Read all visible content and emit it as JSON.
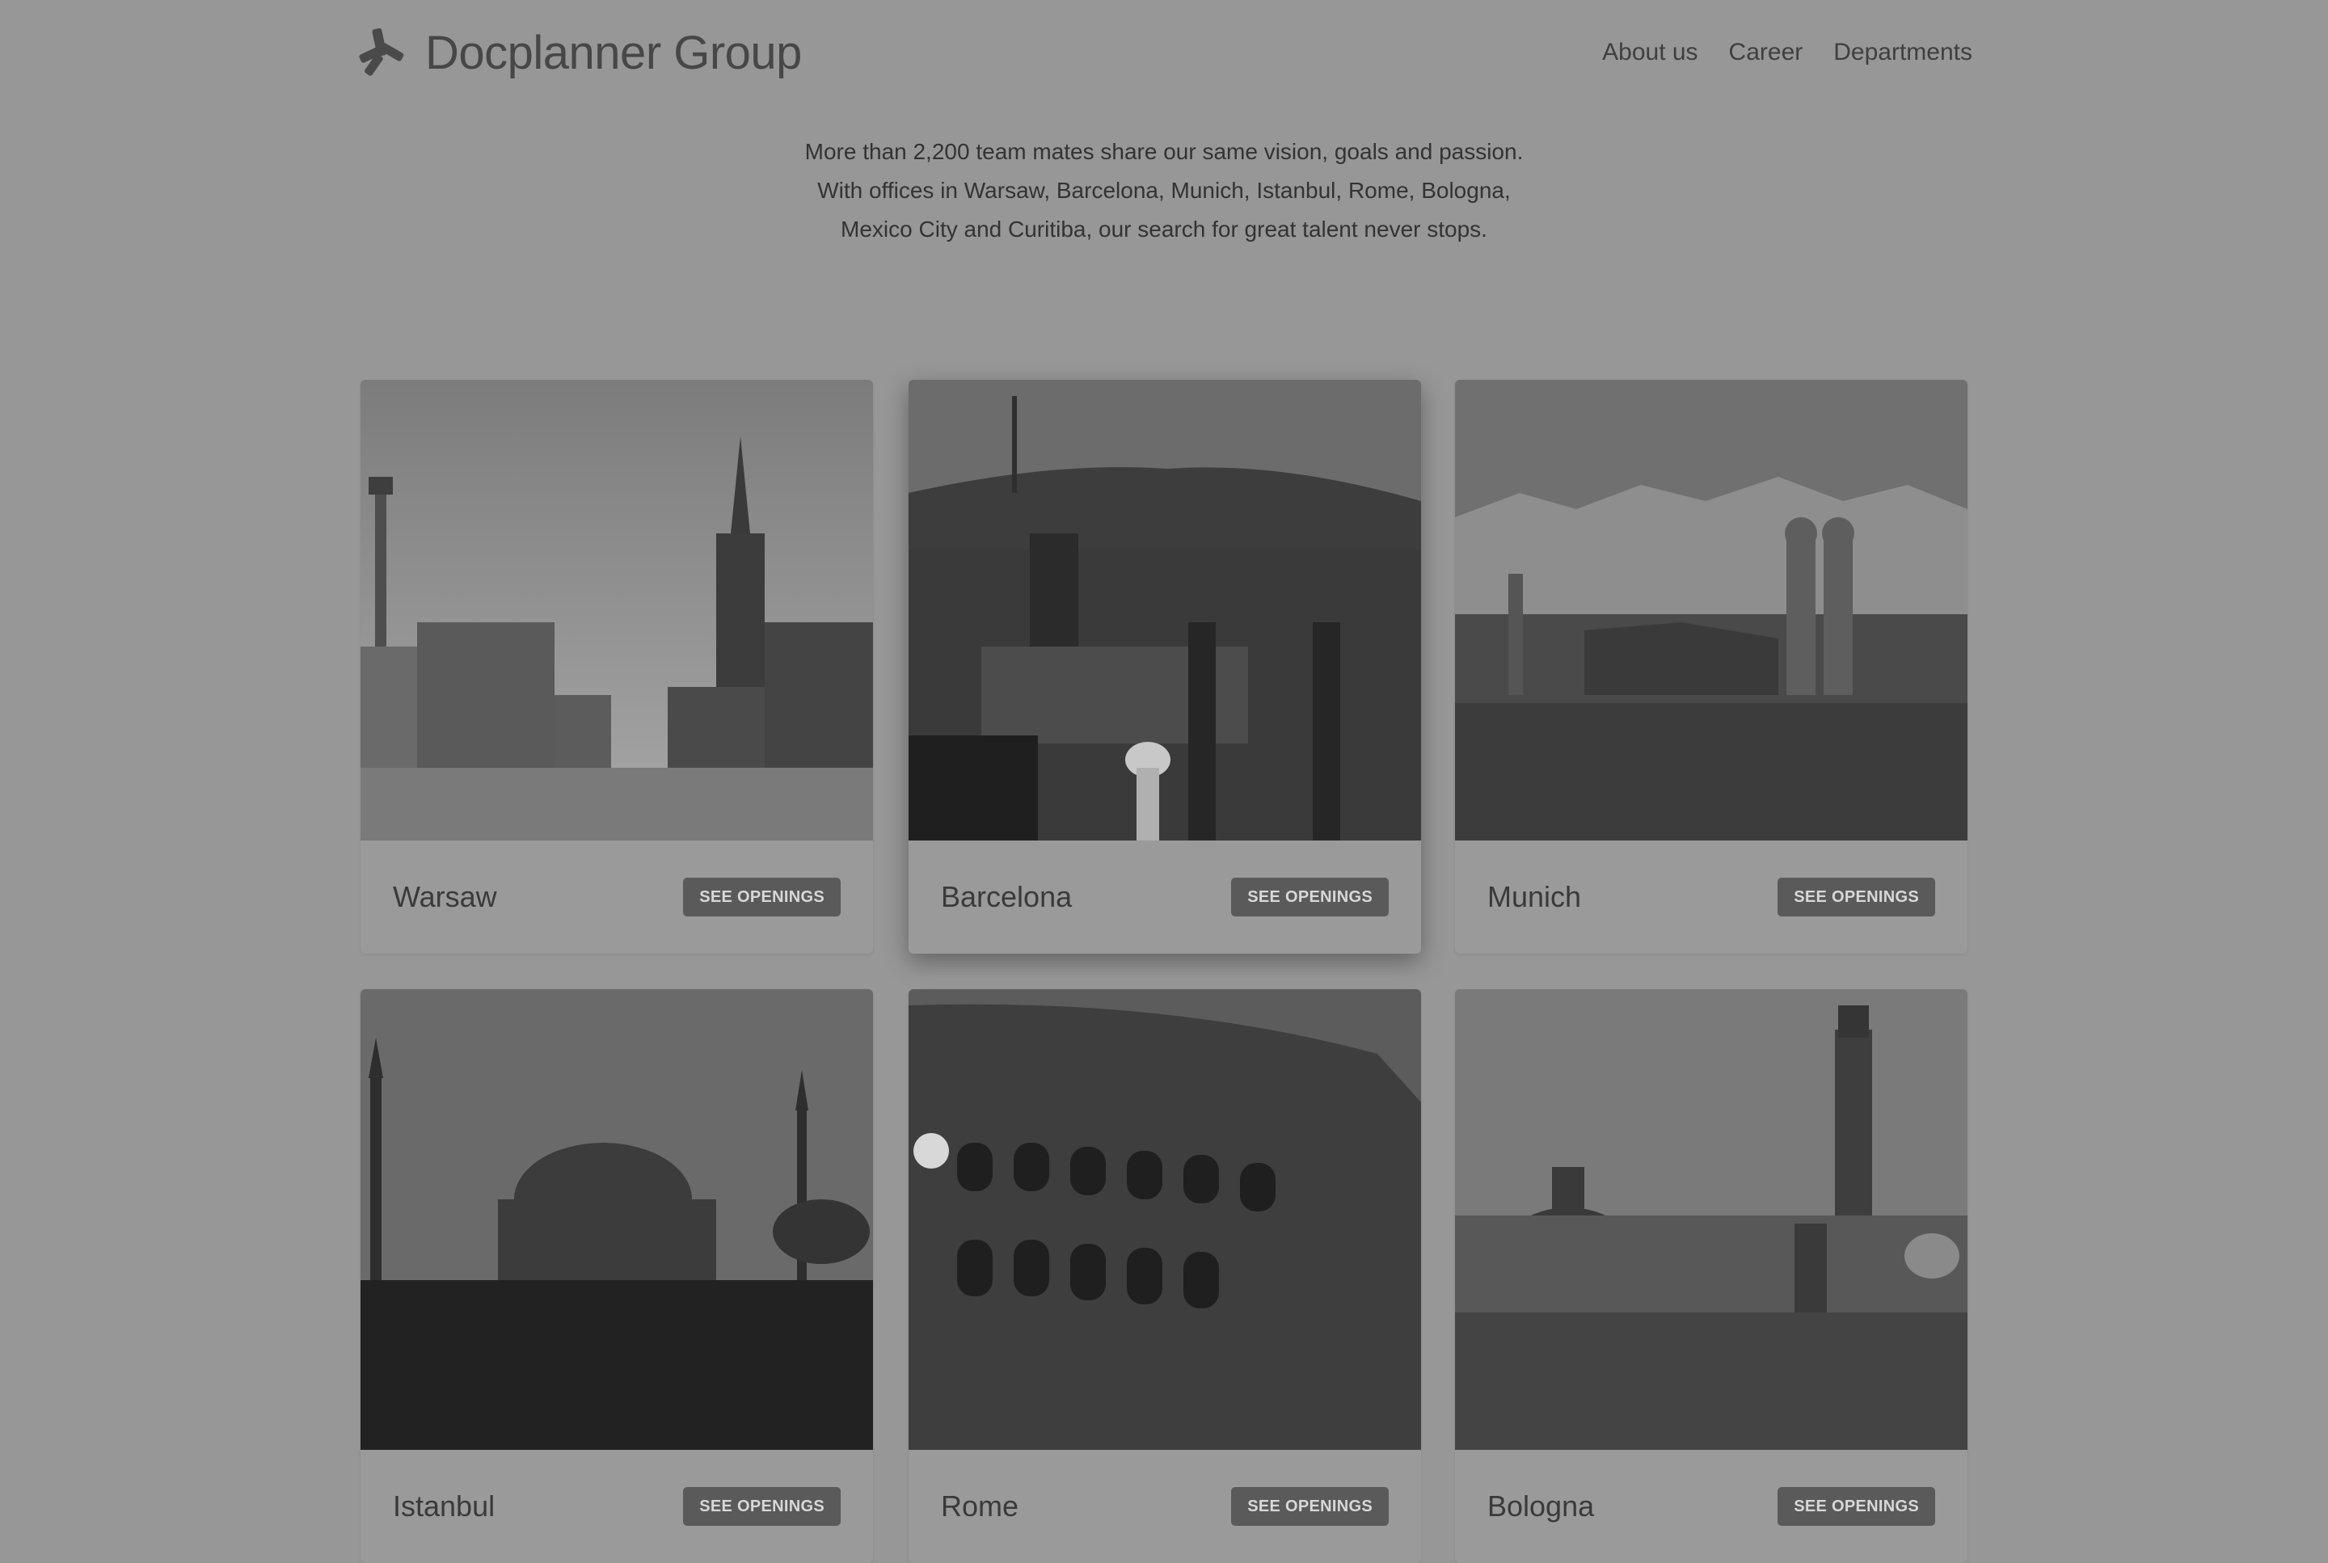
{
  "header": {
    "logo_text": "Docplanner Group",
    "logo_icon": "docplanner-star-icon",
    "nav": [
      {
        "label": "About us"
      },
      {
        "label": "Career"
      },
      {
        "label": "Departments"
      }
    ]
  },
  "intro": {
    "lines": [
      "More than 2,200 team mates share our same vision, goals and passion.",
      "With offices in Warsaw, Barcelona, Munich, Istanbul, Rome, Bologna,",
      "Mexico City and Curitiba, our search for great talent never stops."
    ]
  },
  "cities": [
    {
      "name": "Warsaw",
      "button": "SEE OPENINGS"
    },
    {
      "name": "Barcelona",
      "button": "SEE OPENINGS"
    },
    {
      "name": "Munich",
      "button": "SEE OPENINGS"
    },
    {
      "name": "Istanbul",
      "button": "SEE OPENINGS"
    },
    {
      "name": "Rome",
      "button": "SEE OPENINGS"
    },
    {
      "name": "Bologna",
      "button": "SEE OPENINGS"
    }
  ],
  "colors": {
    "overlay_background": "#979797",
    "button_background": "#5a5a5a"
  }
}
